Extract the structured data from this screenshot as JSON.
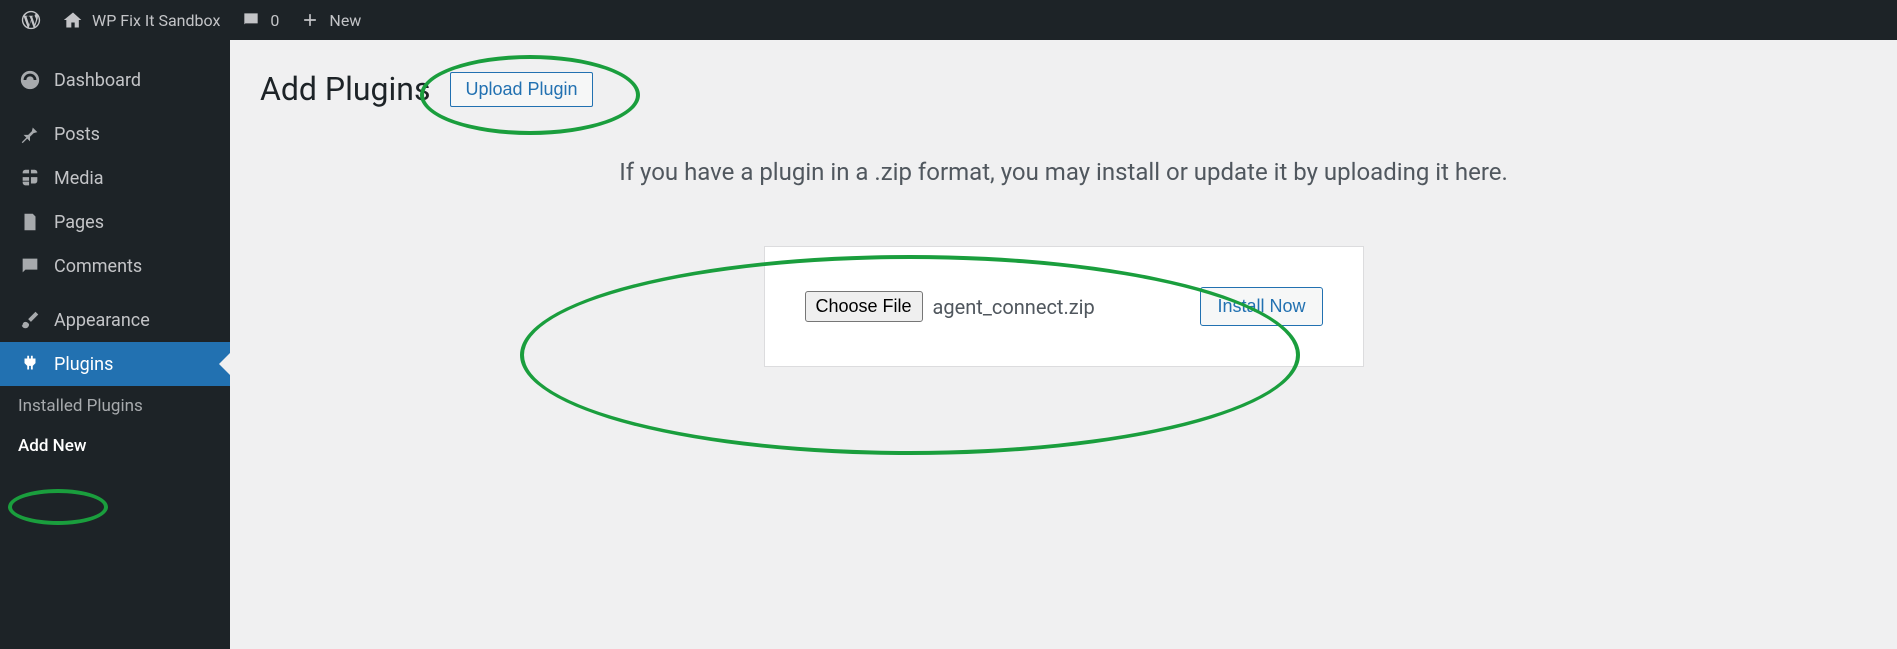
{
  "adminbar": {
    "site_title": "WP Fix It Sandbox",
    "comment_count": "0",
    "new_label": "New"
  },
  "sidebar": {
    "dashboard": "Dashboard",
    "posts": "Posts",
    "media": "Media",
    "pages": "Pages",
    "comments": "Comments",
    "appearance": "Appearance",
    "plugins": "Plugins",
    "installed_plugins": "Installed Plugins",
    "add_new": "Add New"
  },
  "main": {
    "page_title": "Add Plugins",
    "upload_button": "Upload Plugin",
    "description": "If you have a plugin in a .zip format, you may install or update it by uploading it here.",
    "choose_file": "Choose File",
    "file_name": "agent_connect.zip",
    "install_button": "Install Now"
  }
}
